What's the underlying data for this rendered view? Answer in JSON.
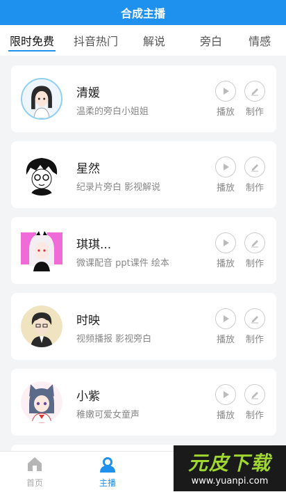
{
  "header": {
    "title": "合成主播"
  },
  "tabs": [
    {
      "label": "限时免费"
    },
    {
      "label": "抖音热门"
    },
    {
      "label": "解说"
    },
    {
      "label": "旁白"
    },
    {
      "label": "情感"
    }
  ],
  "anchors": [
    {
      "name": "清媛",
      "desc": "温柔的旁白小姐姐",
      "play_label": "播放",
      "make_label": "制作"
    },
    {
      "name": "星然",
      "desc": "纪录片旁白  影视解说",
      "play_label": "播放",
      "make_label": "制作"
    },
    {
      "name": "琪琪...",
      "desc": "微课配音 ppt课件 绘本",
      "play_label": "播放",
      "make_label": "制作"
    },
    {
      "name": "时映",
      "desc": "视频播报  影视旁白",
      "play_label": "播放",
      "make_label": "制作"
    },
    {
      "name": "小紫",
      "desc": "稚嫩可爱女童声",
      "play_label": "播放",
      "make_label": "制作"
    }
  ],
  "bottom_nav": [
    {
      "label": "首页",
      "icon": "home-icon"
    },
    {
      "label": "主播",
      "icon": "anchor-user-icon"
    }
  ],
  "watermark": {
    "logo": "元皮下载",
    "url": "www.yuanpi.com"
  },
  "colors": {
    "accent": "#1e90ee",
    "inactive": "#aaaaaa"
  }
}
